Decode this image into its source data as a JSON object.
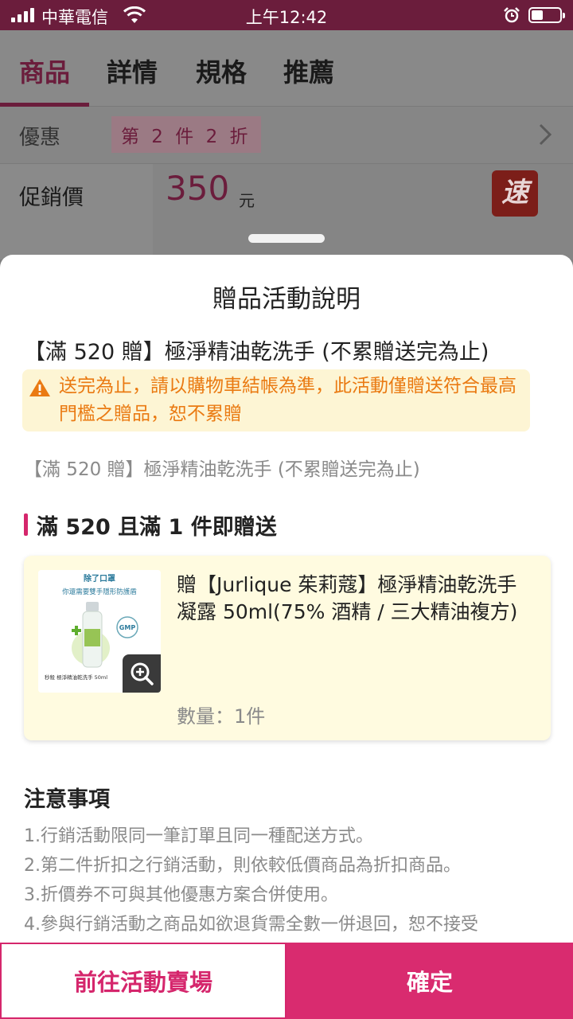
{
  "status_bar": {
    "carrier": "中華電信",
    "time": "上午12:42"
  },
  "background_page": {
    "tabs": [
      "商品",
      "詳情",
      "規格",
      "推薦"
    ],
    "promo": {
      "label": "優惠",
      "badge": "第 2 件 2 折"
    },
    "price": {
      "label": "促銷價",
      "value": "350",
      "unit": "元"
    },
    "speed_badge": "速"
  },
  "sheet": {
    "title": "贈品活動說明",
    "event_name": "【滿 520 贈】極淨精油乾洗手 (不累贈送完為止)",
    "warning": "送完為止，請以購物車結帳為準，此活動僅贈送符合最高門檻之贈品，恕不累贈",
    "event_sub": "【滿 520 贈】極淨精油乾洗手 (不累贈送完為止)",
    "condition_title": "滿 520 且滿 1 件即贈送",
    "gift": {
      "name": "贈【Jurlique 茱莉蔻】極淨精油乾洗手凝露 50ml(75% 酒精 / 三大精油複方)",
      "quantity": "數量：1件",
      "thumb": {
        "line1": "除了口罩",
        "line2": "你還需要雙手隱形防護盾",
        "badge": "GMP",
        "caption": "秒殺 極淨精油乾洗手 50ml"
      }
    },
    "notes_title": "注意事項",
    "notes": [
      "1.行銷活動限同一筆訂單且同一種配送方式。",
      "2.第二件折扣之行銷活動，則依較低價商品為折扣商品。",
      "3.折價券不可與其他優惠方案合併使用。",
      "4.參與行銷活動之商品如欲退貨需全數一併退回，恕不接受"
    ]
  },
  "buttons": {
    "goto": "前往活動賣場",
    "confirm": "確定"
  },
  "colors": {
    "accent": "#d92b6f",
    "warning_text": "#ea7a12",
    "warning_bg": "#fdf5d4",
    "status_bar": "#6b1d3c"
  }
}
